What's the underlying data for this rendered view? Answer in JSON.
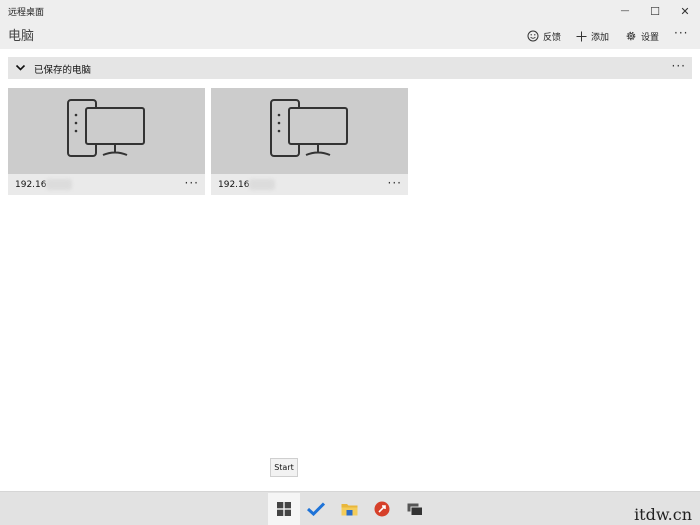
{
  "window": {
    "title": "远程桌面",
    "minimize_glyph": "—",
    "maximize_glyph": "☐",
    "close_glyph": "✕"
  },
  "header": {
    "title": "电脑",
    "feedback_label": "反馈",
    "add_label": "添加",
    "settings_label": "设置",
    "more_glyph": "···"
  },
  "group": {
    "label": "已保存的电脑",
    "more_glyph": "···"
  },
  "tiles": [
    {
      "ip": "192.16",
      "more_glyph": "···"
    },
    {
      "ip": "192.16",
      "more_glyph": "···"
    }
  ],
  "tooltip": {
    "text": "Start"
  },
  "taskbar": {
    "icons": [
      "windows-start-icon",
      "todo-check-icon",
      "file-explorer-icon",
      "remote-desktop-icon",
      "task-view-icon"
    ]
  },
  "footer": {
    "watermark": "itdw.cn"
  },
  "colors": {
    "chrome_bg": "#eeeeee",
    "group_bg": "#e5e5e5",
    "thumb_bg": "#cccccc",
    "taskbar_bg": "#e2e2e2",
    "check_blue": "#1e73d8",
    "folder_yellow": "#e9b73b",
    "rdp_red": "#d6402a"
  }
}
